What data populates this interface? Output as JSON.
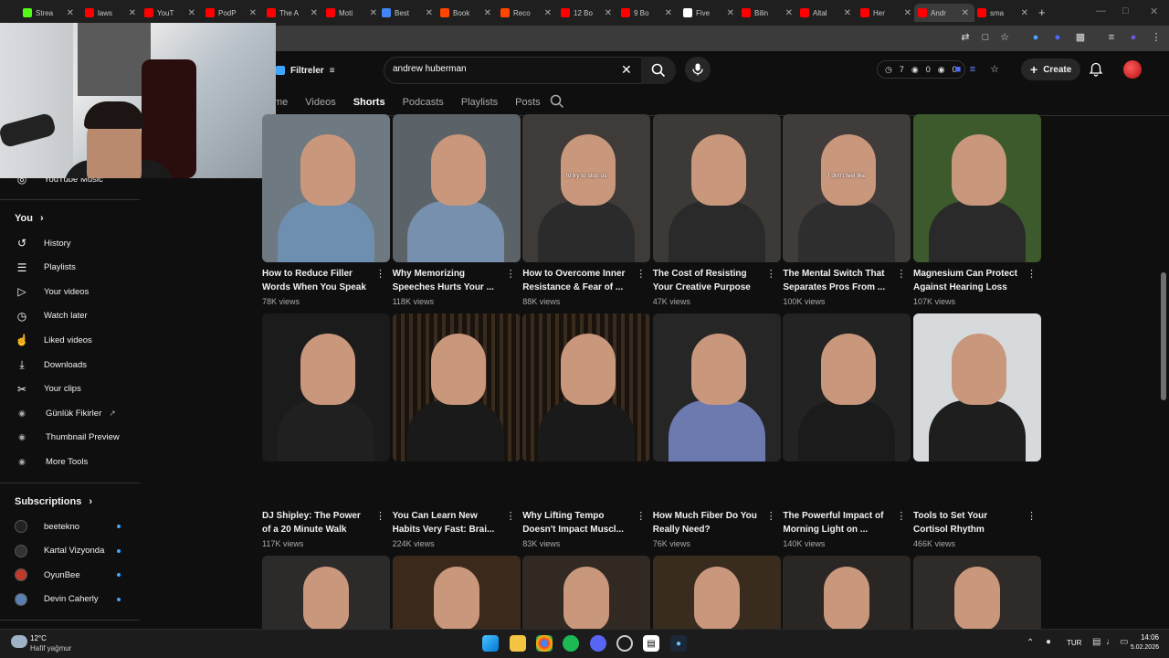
{
  "browser": {
    "tabs": [
      {
        "label": "Strea",
        "color": "#53fc18"
      },
      {
        "label": "laws",
        "color": "#ff0000"
      },
      {
        "label": "YouT",
        "color": "#ff0000"
      },
      {
        "label": "PodP",
        "color": "#ff0000"
      },
      {
        "label": "The A",
        "color": "#ff0000"
      },
      {
        "label": "Moti",
        "color": "#ff0000"
      },
      {
        "label": "Best",
        "color": "#4285f4"
      },
      {
        "label": "Book",
        "color": "#ff4500"
      },
      {
        "label": "Reco",
        "color": "#ff4500"
      },
      {
        "label": "12 Bo",
        "color": "#ff0000"
      },
      {
        "label": "9 Bo",
        "color": "#ff0000"
      },
      {
        "label": "Five",
        "color": "#ffffff"
      },
      {
        "label": "Bilin",
        "color": "#ff0000"
      },
      {
        "label": "Altal",
        "color": "#ff0000"
      },
      {
        "label": "Her",
        "color": "#ff0000"
      },
      {
        "label": "Andr",
        "color": "#ff0000"
      },
      {
        "label": "sma",
        "color": "#ff0000"
      }
    ],
    "new_tab": "+"
  },
  "header": {
    "filters_label": "Filtreler",
    "search_value": "andrew huberman",
    "stats": [
      "7",
      "0",
      "0"
    ],
    "create_label": "Create"
  },
  "channel_tabs": [
    "me",
    "Videos",
    "Shorts",
    "Podcasts",
    "Playlists",
    "Posts"
  ],
  "active_tab": "Shorts",
  "sidebar": {
    "top_item": "YouTube Music",
    "you_heading": "You",
    "you_items": [
      "History",
      "Playlists",
      "Your videos",
      "Watch later",
      "Liked videos",
      "Downloads",
      "Your clips",
      "Günlük Fikirler",
      "Thumbnail Preview",
      "More Tools"
    ],
    "subs_heading": "Subscriptions",
    "subs": [
      "beetekno",
      "Kartal Vizyonda",
      "OyunBee",
      "Devin Caherly"
    ]
  },
  "videos_row1": [
    {
      "title1": "How to Reduce Filler",
      "title2": "Words When You Speak",
      "views": "78K views",
      "bg": "#6f7982",
      "shirt": "#6f8fb0",
      "caption": ""
    },
    {
      "title1": "Why Memorizing",
      "title2": "Speeches Hurts Your ...",
      "views": "118K views",
      "bg": "#5c6368",
      "shirt": "#7790ad",
      "caption": ""
    },
    {
      "title1": "How to Overcome Inner",
      "title2": "Resistance & Fear of ...",
      "views": "88K views",
      "bg": "#3e3b38",
      "shirt": "#2b2b2b",
      "caption": "to try to stop us"
    },
    {
      "title1": "The Cost of Resisting",
      "title2": "Your Creative Purpose",
      "views": "47K views",
      "bg": "#3c3a37",
      "shirt": "#2a2a2a",
      "caption": ""
    },
    {
      "title1": "The Mental Switch That",
      "title2": "Separates Pros From ...",
      "views": "100K views",
      "bg": "#3f3c39",
      "shirt": "#2e2e2e",
      "caption": "I don't feel like"
    },
    {
      "title1": "Magnesium Can Protect",
      "title2": "Against Hearing Loss",
      "views": "107K views",
      "bg": "#3d5a2d",
      "shirt": "#2a2a2a",
      "caption": ""
    }
  ],
  "videos_row2": [
    {
      "title1": "DJ Shipley: The Power",
      "title2": "of a 20 Minute Walk",
      "views": "117K views",
      "bg": "#1b1b1b",
      "shirt": "#202020"
    },
    {
      "title1": "You Can Learn New",
      "title2": "Habits Very Fast: Brai...",
      "views": "224K views",
      "bg": "#2a1f16",
      "shirt": "#1a1a1a"
    },
    {
      "title1": "Why Lifting Tempo",
      "title2": "Doesn't Impact Muscl...",
      "views": "83K views",
      "bg": "#2a1f16",
      "shirt": "#1a1a1a"
    },
    {
      "title1": "How Much Fiber Do You",
      "title2": "Really Need?",
      "views": "76K views",
      "bg": "#262626",
      "shirt": "#6c7ab0"
    },
    {
      "title1": "The Powerful Impact of",
      "title2": "Morning Light on ...",
      "views": "140K views",
      "bg": "#232323",
      "shirt": "#1b1b1b"
    },
    {
      "title1": "Tools to Set Your",
      "title2": "Cortisol Rhythm",
      "views": "466K views",
      "bg": "#d7dadc",
      "shirt": "#1e1e1e"
    }
  ],
  "videos_row3_bg": [
    "#2d2b29",
    "#3b2a1b",
    "#322a22",
    "#3a2b1f",
    "#2a2624",
    "#2f2b28"
  ],
  "taskbar": {
    "weather_temp": "12°C",
    "weather_desc": "Hafif yağmur",
    "lang": "TUR",
    "time": "14:06",
    "date": "5.02.2026"
  }
}
